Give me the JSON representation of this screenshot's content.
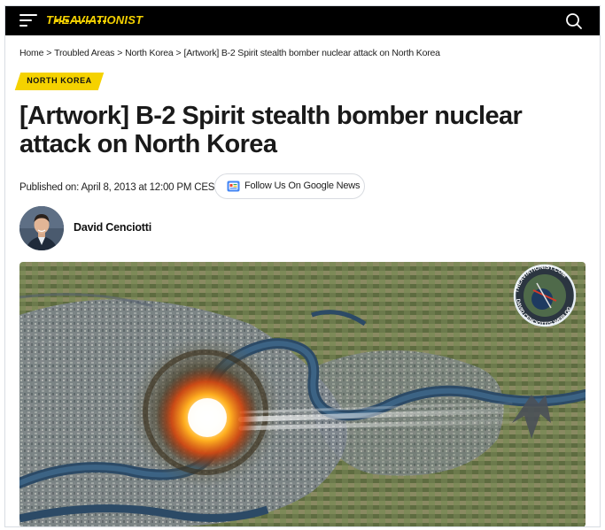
{
  "header": {
    "logo_text": "THEAVIATIONIST",
    "menu_icon": "hamburger-menu-icon",
    "search_icon": "search-icon",
    "accent_color": "#f5d200",
    "background_color": "#000000"
  },
  "breadcrumb": {
    "items": [
      "Home",
      "Troubled Areas",
      "North Korea",
      "[Artwork] B-2 Spirit stealth bomber nuclear attack on North Korea"
    ],
    "separator": ">"
  },
  "category_tag": "NORTH KOREA",
  "article": {
    "title": "[Artwork] B-2 Spirit stealth bomber nuclear attack on North Korea",
    "published": "Published on: April 8, 2013 at 12:00 PM CEST",
    "follow_label": "Follow Us On Google News",
    "author": "David Cenciotti"
  },
  "hero_image": {
    "watermark_top": "THEAVIATIONIST.COM",
    "watermark_bottom": "DAVID CENCIOTTI'S WEBLOG"
  }
}
